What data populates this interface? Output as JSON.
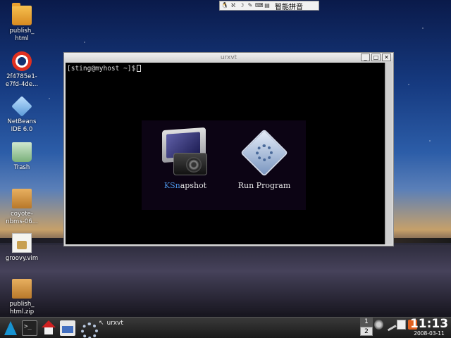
{
  "input_method": {
    "label": "智能拼音",
    "icons": [
      "tux-icon",
      "pinyin-icon",
      "moon-icon",
      "pen-icon",
      "keyboard-icon",
      "menu-icon"
    ]
  },
  "desktop_icons": [
    {
      "label": "publish_\nhtml",
      "icon": "folder-icon"
    },
    {
      "label": "2f4785e1-\ne7fd-4de...",
      "icon": "lifebuoy-icon"
    },
    {
      "label": "NetBeans\nIDE 6.0",
      "icon": "netbeans-icon"
    },
    {
      "label": "Trash",
      "icon": "trash-icon"
    },
    {
      "label": "coyote-\nnbms-06...",
      "icon": "package-icon"
    },
    {
      "label": "groovy.vim",
      "icon": "vim-file-icon"
    },
    {
      "label": "publish_\nhtml.zip",
      "icon": "archive-icon"
    }
  ],
  "window": {
    "title": "urxvt",
    "buttons": {
      "minimize": "_",
      "maximize": "□",
      "close": "✕"
    },
    "prompt": "[sting@myhost ~]$"
  },
  "launcher": {
    "items": [
      {
        "label_highlight": "KSn",
        "label_rest": "apshot",
        "icon": "ksnapshot-icon"
      },
      {
        "label": "Run Program",
        "icon": "run-program-icon"
      }
    ]
  },
  "taskbar": {
    "task_label": "urxvt",
    "pager": [
      "1",
      "2"
    ],
    "clock": {
      "time": "11:13",
      "date": "2008-03-11"
    }
  }
}
